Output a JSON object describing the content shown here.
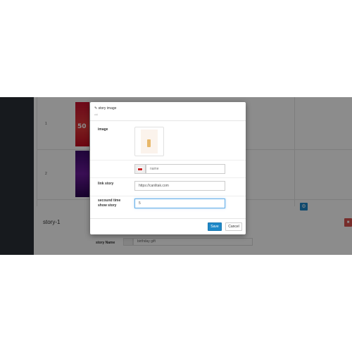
{
  "background": {
    "table_rows": [
      {
        "number": "1"
      },
      {
        "number": "2"
      }
    ],
    "thumb_red_text": "50",
    "story_heading": "story-1",
    "story_name_label": "story Name",
    "story_name_value": "birthday gift",
    "gear_icon": "gear-icon",
    "delete_icon": "trash-icon"
  },
  "modal": {
    "title": "story image",
    "subtitle": "ckl",
    "image_label": "image",
    "name_placeholder": "name",
    "link_label": "link story",
    "link_value": "https://canlitak.com",
    "second_time_label_line1": "secound time",
    "second_time_label_line2": "show story",
    "second_time_value": "5",
    "save_label": "Save",
    "cancel_label": "Cancel"
  },
  "colors": {
    "primary": "#1e88c8",
    "danger": "#d9534f",
    "sidebar": "#2b3138"
  }
}
